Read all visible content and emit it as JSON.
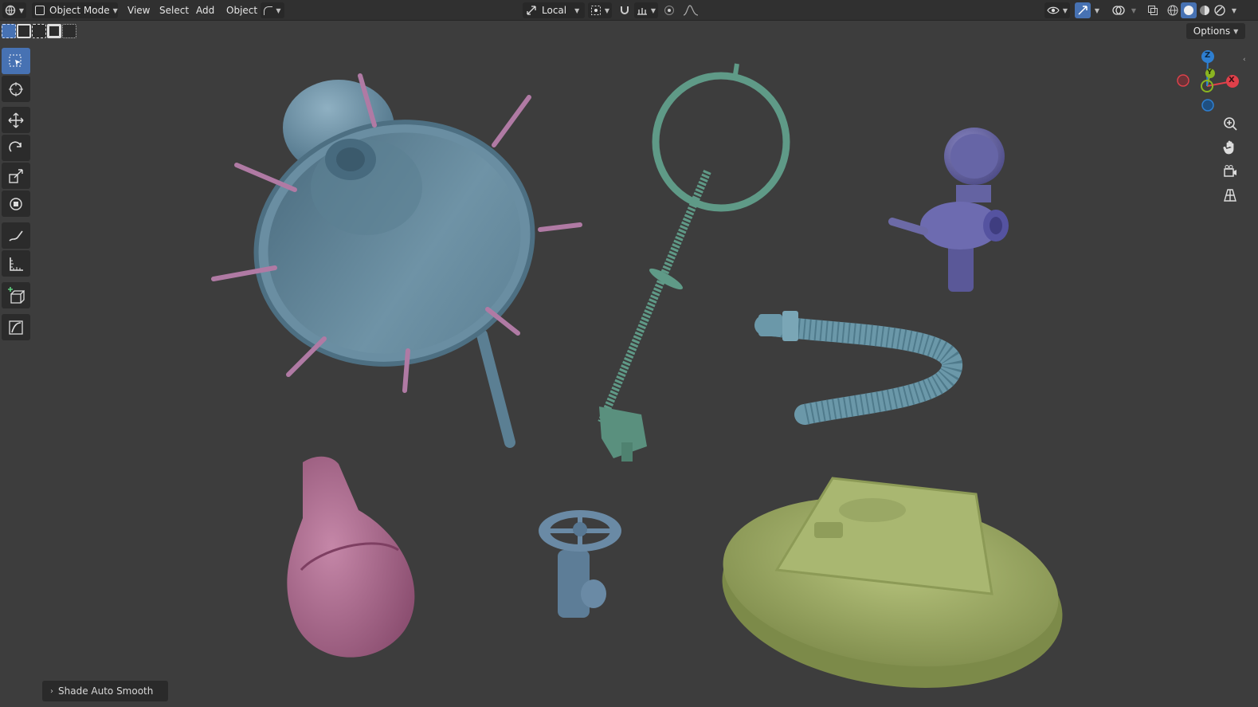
{
  "header": {
    "mode_label": "Object Mode",
    "menus": [
      "View",
      "Select",
      "Add",
      "Object"
    ],
    "transform_orientation": "Local",
    "options_label": "Options"
  },
  "status": {
    "last_operator": "Shade Auto Smooth"
  },
  "gizmo": {
    "x_label": "X",
    "y_label": "Y",
    "z_label": "Z"
  },
  "colors": {
    "viewport_bg": "#3d3d3d",
    "header_bg": "#303030",
    "active_tool": "#4772b3",
    "axis_x": "#e0404a",
    "axis_y": "#8ab521",
    "axis_z": "#2e7fd1",
    "lamp": "#6b8ea3",
    "bolts": "#b07aa4",
    "ring_key": "#5f9a87",
    "gauge": "#6c6aa6",
    "hose": "#6b98a9",
    "bulb": "#b06f93",
    "valve": "#6a8aa5",
    "hatch": "#a3b26a"
  },
  "tools": [
    "select-box",
    "cursor",
    "move",
    "rotate",
    "scale",
    "transform",
    "annotate",
    "measure",
    "add-cube",
    "shear"
  ]
}
